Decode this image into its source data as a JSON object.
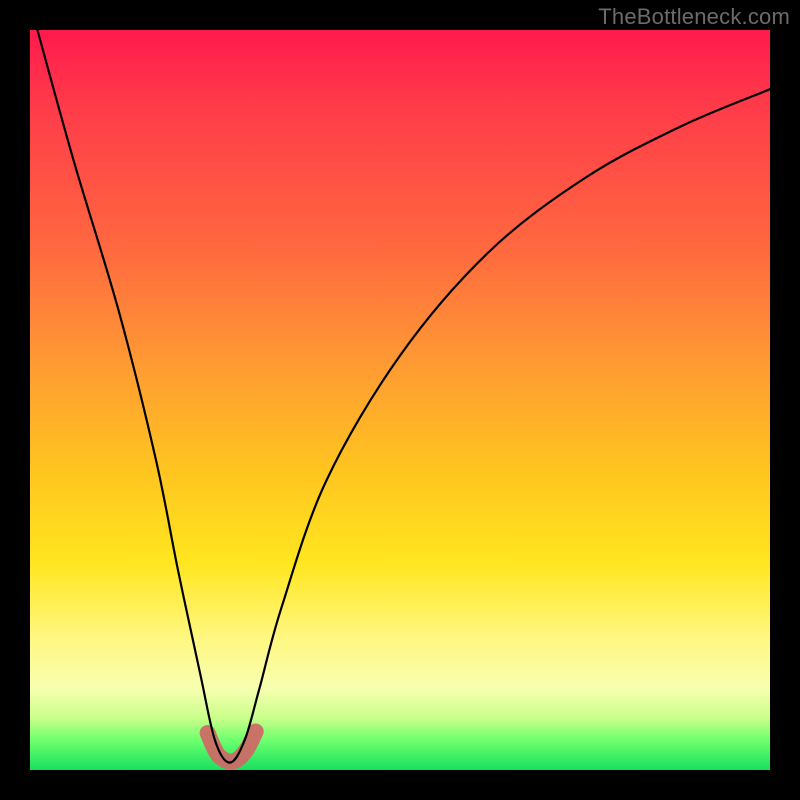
{
  "watermark": "TheBottleneck.com",
  "chart_data": {
    "type": "line",
    "title": "",
    "xlabel": "",
    "ylabel": "",
    "xlim": [
      0,
      100
    ],
    "ylim": [
      0,
      100
    ],
    "grid": false,
    "legend": false,
    "note": "Axes are unlabeled; values are estimated in percent of plot width/height. y is abstract 'bottleneck %' (top=100, bottom=0). Curve minimum ~x=27.",
    "series": [
      {
        "name": "bottleneck-curve",
        "x": [
          1,
          6,
          12,
          17,
          20,
          23,
          25,
          27,
          29,
          31,
          34,
          40,
          50,
          62,
          75,
          88,
          100
        ],
        "y": [
          100,
          82,
          62,
          42,
          27,
          13,
          4,
          1,
          4,
          11,
          22,
          39,
          56,
          70,
          80,
          87,
          92
        ]
      }
    ],
    "marker": {
      "name": "optimal-range",
      "x": [
        24.0,
        25.3,
        26.7,
        28.0,
        29.3,
        30.5
      ],
      "y": [
        5.0,
        2.2,
        1.2,
        1.4,
        2.8,
        5.2
      ]
    },
    "background_gradient": {
      "top": "#ff1a4d",
      "mid": "#ffd61f",
      "bottom": "#18e060"
    }
  }
}
